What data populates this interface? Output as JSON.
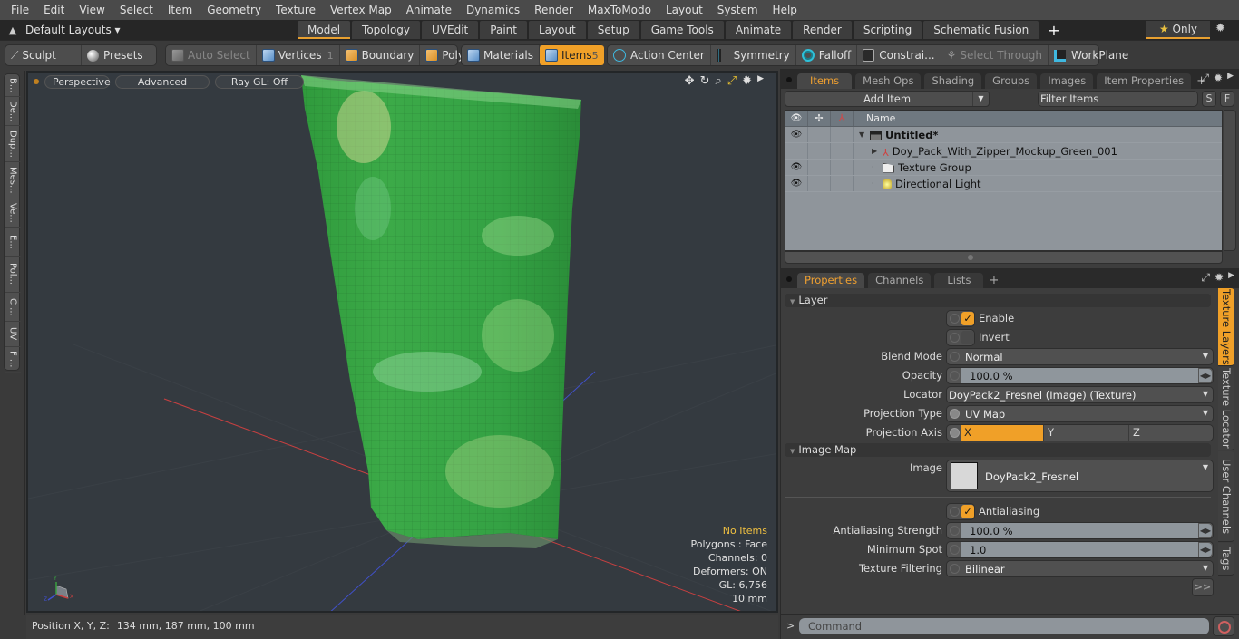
{
  "menu": [
    "File",
    "Edit",
    "View",
    "Select",
    "Item",
    "Geometry",
    "Texture",
    "Vertex Map",
    "Animate",
    "Dynamics",
    "Render",
    "MaxToModo",
    "Layout",
    "System",
    "Help"
  ],
  "layout": {
    "dropdown_label": "Default Layouts",
    "tabs": [
      "Model",
      "Topology",
      "UVEdit",
      "Paint",
      "Layout",
      "Setup",
      "Game Tools",
      "Animate",
      "Render",
      "Scripting",
      "Schematic Fusion"
    ],
    "active_tab": "Model",
    "add_label": "+",
    "only_label": "Only"
  },
  "toolbar": {
    "sculpt": "Sculpt",
    "presets": "Presets",
    "auto_select": "Auto Select",
    "vertices": "Vertices",
    "vertices_count": "1",
    "boundary": "Boundary",
    "polygons": "Polygons",
    "materials": "Materials",
    "items": "Items",
    "items_count": "5",
    "action_center": "Action Center",
    "symmetry": "Symmetry",
    "falloff": "Falloff",
    "constraints": "Constrai...",
    "select_through": "Select Through",
    "workplane": "WorkPlane"
  },
  "left_tabs": [
    "B...",
    "De...",
    "Dup...",
    "Mes...",
    "Ve...",
    "E...",
    "Pol...",
    "C ...",
    "UV",
    "F ..."
  ],
  "viewport": {
    "view_label": "Perspective",
    "shading_label": "Advanced",
    "raygl_label": "Ray GL: Off",
    "info": {
      "selection": "No Items",
      "polygons": "Polygons : Face",
      "channels": "Channels: 0",
      "deformers": "Deformers: ON",
      "gl": "GL: 6,756",
      "grid": "10 mm"
    },
    "colors": {
      "mesh_green": "#3aa848",
      "axis_x": "#c84040",
      "axis_z": "#4050c8",
      "background": "#343a40"
    }
  },
  "status": {
    "position_label": "Position X, Y, Z:",
    "position_value": "134 mm, 187 mm, 100 mm"
  },
  "items_panel": {
    "tabs": [
      "Items",
      "Mesh Ops",
      "Shading",
      "Groups",
      "Images",
      "Item Properties"
    ],
    "active_tab": "Items",
    "add_item": "Add Item",
    "filter_placeholder": "Filter Items",
    "s_button": "S",
    "f_button": "F",
    "column_name": "Name",
    "rows": [
      {
        "name": "Untitled*",
        "visible": true,
        "bold": true,
        "icon": "scene-icon",
        "depth": 0
      },
      {
        "name": "Doy_Pack_With_Zipper_Mockup_Green_001",
        "visible": false,
        "bold": false,
        "icon": "mesh-locator-icon",
        "depth": 1
      },
      {
        "name": "Texture Group",
        "visible": true,
        "bold": false,
        "icon": "texture-group-icon",
        "depth": 1
      },
      {
        "name": "Directional Light",
        "visible": true,
        "bold": false,
        "icon": "light-icon",
        "depth": 1
      }
    ]
  },
  "properties_panel": {
    "tabs": [
      "Properties",
      "Channels",
      "Lists"
    ],
    "active_tab": "Properties",
    "sections": {
      "layer": "Layer",
      "image_map": "Image Map"
    },
    "enable_label": "Enable",
    "enable_checked": true,
    "invert_label": "Invert",
    "invert_checked": false,
    "blend_mode_label": "Blend Mode",
    "blend_mode_value": "Normal",
    "opacity_label": "Opacity",
    "opacity_value": "100.0 %",
    "locator_label": "Locator",
    "locator_value": "DoyPack2_Fresnel (Image) (Texture)",
    "projection_type_label": "Projection Type",
    "projection_type_value": "UV Map",
    "projection_axis_label": "Projection Axis",
    "projection_axis_options": [
      "X",
      "Y",
      "Z"
    ],
    "projection_axis_selected": "X",
    "image_label": "Image",
    "image_value": "DoyPack2_Fresnel",
    "antialiasing_label": "Antialiasing",
    "antialiasing_checked": true,
    "aa_strength_label": "Antialiasing Strength",
    "aa_strength_value": "100.0 %",
    "min_spot_label": "Minimum Spot",
    "min_spot_value": "1.0",
    "tex_filter_label": "Texture Filtering",
    "tex_filter_value": "Bilinear",
    "more_button": ">>",
    "side_tabs": [
      "Texture Layers",
      "Texture Locator",
      "User Channels",
      "Tags"
    ],
    "side_active": "Texture Layers"
  },
  "command": {
    "prompt": ">",
    "placeholder": "Command"
  },
  "accent_color": "#f0a028"
}
